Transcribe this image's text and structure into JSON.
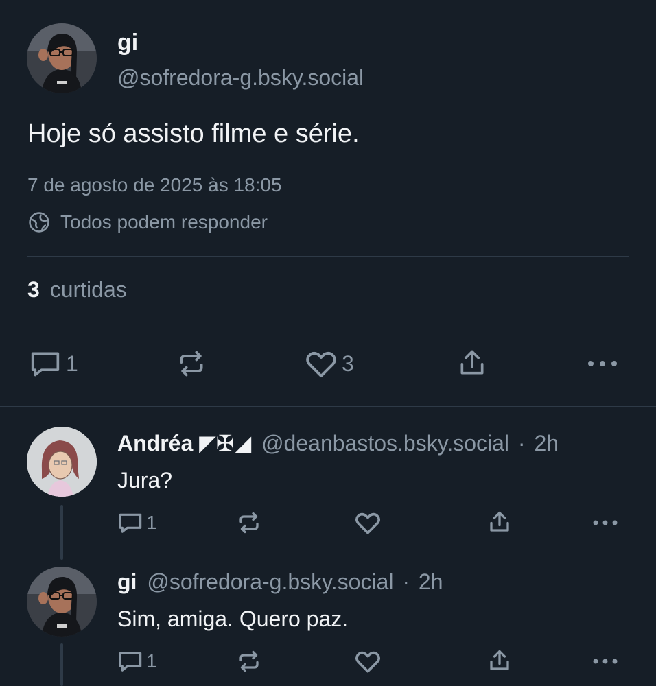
{
  "post": {
    "author_name": "gi",
    "author_handle": "@sofredora-g.bsky.social",
    "text": "Hoje só assisto filme e série.",
    "timestamp": "7 de agosto de 2025 às 18:05",
    "reply_setting": "Todos podem responder",
    "likes_count": "3",
    "likes_label": "curtidas",
    "actions": {
      "reply_count": "1",
      "like_count": "3"
    }
  },
  "replies": [
    {
      "author_name": "Andréa ◤✠◢",
      "author_handle": "@deanbastos.bsky.social",
      "separator": "·",
      "time": "2h",
      "text": "Jura?",
      "reply_count": "1"
    },
    {
      "author_name": "gi",
      "author_handle": "@sofredora-g.bsky.social",
      "separator": "·",
      "time": "2h",
      "text": "Sim, amiga. Quero paz.",
      "reply_count": "1"
    }
  ],
  "colors": {
    "background": "#161e27",
    "text": "#f1f3f5",
    "muted": "#8b98a5",
    "divider": "#2e3a47"
  },
  "icons": [
    "reply-icon",
    "repost-icon",
    "like-icon",
    "share-icon",
    "more-icon",
    "globe-icon"
  ]
}
